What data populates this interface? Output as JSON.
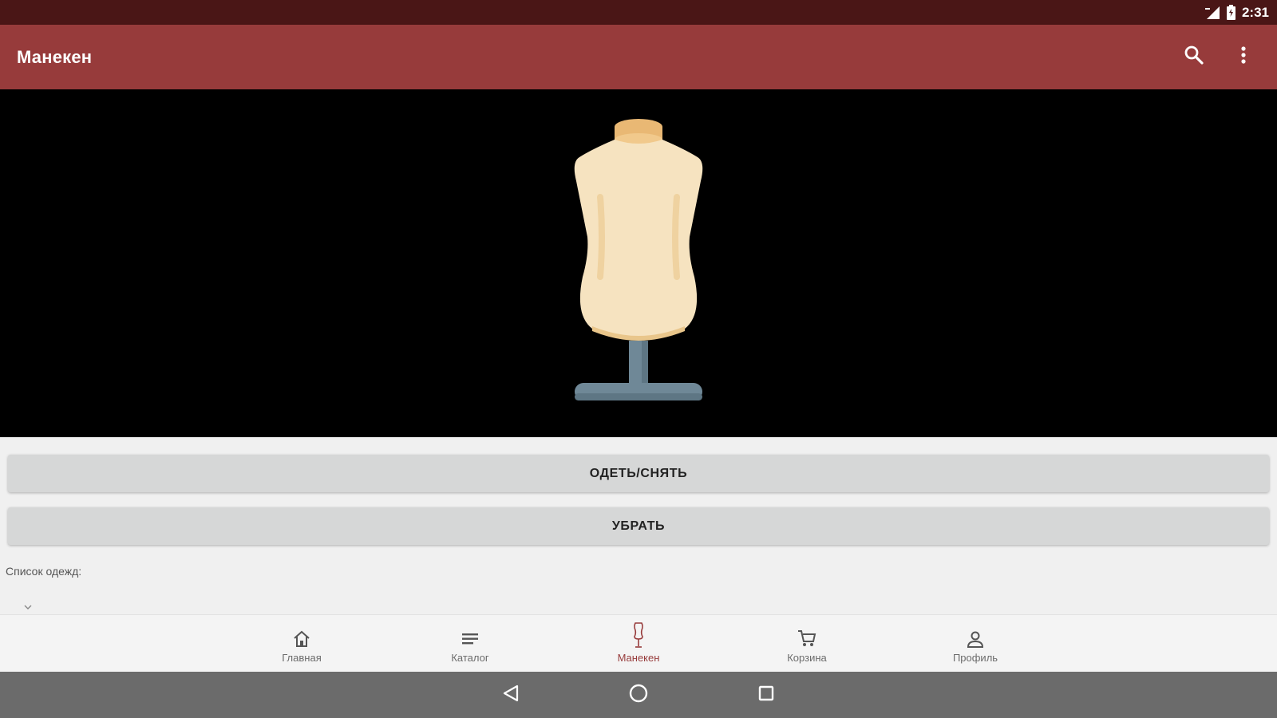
{
  "status_bar": {
    "time": "2:31",
    "icons": [
      "signal-icon",
      "battery-icon"
    ]
  },
  "app_bar": {
    "title": "Манекен",
    "actions": [
      "search-icon",
      "more-vert-icon"
    ]
  },
  "viewer": {
    "image": "dress-form-mannequin"
  },
  "buttons": {
    "dress_toggle": "ОДЕТЬ/СНЯТЬ",
    "remove": "УБРАТЬ"
  },
  "clothes_list": {
    "label": "Список одежд:"
  },
  "bottom_nav": {
    "items": [
      {
        "label": "Главная",
        "icon": "home-icon"
      },
      {
        "label": "Каталог",
        "icon": "list-icon"
      },
      {
        "label": "Манекен",
        "icon": "mannequin-icon",
        "active": true
      },
      {
        "label": "Корзина",
        "icon": "cart-icon"
      },
      {
        "label": "Профиль",
        "icon": "person-icon"
      }
    ]
  },
  "system_nav": [
    "back-icon",
    "home-circle-icon",
    "recents-icon"
  ],
  "colors": {
    "status_bar": "#4a1616",
    "app_bar": "#973b3b",
    "accent": "#973b3b",
    "viewer_bg": "#000000",
    "button_bg": "#d6d7d7",
    "system_nav": "#6b6b6b"
  }
}
